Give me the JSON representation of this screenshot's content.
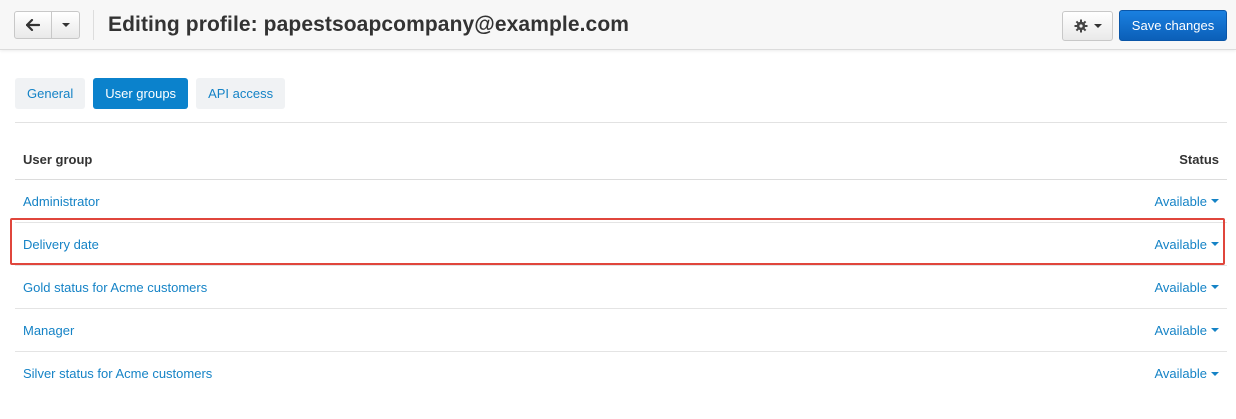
{
  "header": {
    "title": "Editing profile: papestsoapcompany@example.com",
    "save_label": "Save changes",
    "back_icon": "arrow-left-icon",
    "gear_icon": "gear-icon"
  },
  "tabs": [
    {
      "label": "General",
      "active": false
    },
    {
      "label": "User groups",
      "active": true
    },
    {
      "label": "API access",
      "active": false
    }
  ],
  "table": {
    "col_group": "User group",
    "col_status": "Status",
    "rows": [
      {
        "group": "Administrator",
        "status": "Available"
      },
      {
        "group": "Delivery date",
        "status": "Available"
      },
      {
        "group": "Gold status for Acme customers",
        "status": "Available"
      },
      {
        "group": "Manager",
        "status": "Available"
      },
      {
        "group": "Silver status for Acme customers",
        "status": "Available"
      }
    ]
  },
  "colors": {
    "accent": "#0b82cc",
    "link": "#1583c6",
    "highlight": "#e0463c"
  }
}
